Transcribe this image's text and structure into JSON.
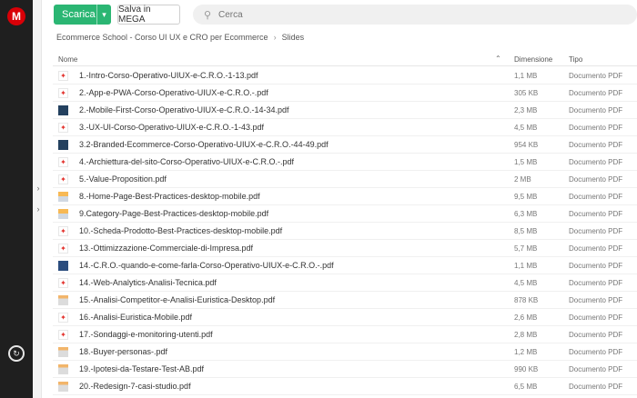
{
  "app": {
    "logo_text": "M",
    "brand_color": "#d90007"
  },
  "toolbar": {
    "download_label": "Scarica",
    "save_label": "Salva in MEGA",
    "search_placeholder": "Cerca",
    "download_color": "#2bb673"
  },
  "breadcrumb": {
    "items": [
      "Ecommerce School - Corso UI UX e CRO per Ecommerce",
      "Slides"
    ],
    "separator": "›"
  },
  "table": {
    "columns": {
      "name": "Nome",
      "size": "Dimensione",
      "type": "Tipo"
    },
    "rows": [
      {
        "name": "1.-Intro-Corso-Operativo-UIUX-e-C.R.O.-1-13.pdf",
        "size": "1,1 MB",
        "type": "Documento PDF",
        "icon": "pdf-icon"
      },
      {
        "name": "2.-App-e-PWA-Corso-Operativo-UIUX-e-C.R.O.-.pdf",
        "size": "305 KB",
        "type": "Documento PDF",
        "icon": "pdf-icon"
      },
      {
        "name": "2.-Mobile-First-Corso-Operativo-UIUX-e-C.R.O.-14-34.pdf",
        "size": "2,3 MB",
        "type": "Documento PDF",
        "icon": "thumbnail-dark"
      },
      {
        "name": "3.-UX-UI-Corso-Operativo-UIUX-e-C.R.O.-1-43.pdf",
        "size": "4,5 MB",
        "type": "Documento PDF",
        "icon": "pdf-icon"
      },
      {
        "name": "3.2-Branded-Ecommerce-Corso-Operativo-UIUX-e-C.R.O.-44-49.pdf",
        "size": "954 KB",
        "type": "Documento PDF",
        "icon": "thumbnail-dark"
      },
      {
        "name": "4.-Archiettura-del-sito-Corso-Operativo-UIUX-e-C.R.O.-.pdf",
        "size": "1,5 MB",
        "type": "Documento PDF",
        "icon": "pdf-icon"
      },
      {
        "name": "5.-Value-Proposition.pdf",
        "size": "2 MB",
        "type": "Documento PDF",
        "icon": "pdf-icon"
      },
      {
        "name": "8.-Home-Page-Best-Practices-desktop-mobile.pdf",
        "size": "9,5 MB",
        "type": "Documento PDF",
        "icon": "thumbnail-orange"
      },
      {
        "name": "9.Category-Page-Best-Practices-desktop-mobile.pdf",
        "size": "6,3 MB",
        "type": "Documento PDF",
        "icon": "thumbnail-orange"
      },
      {
        "name": "10.-Scheda-Prodotto-Best-Practices-desktop-mobile.pdf",
        "size": "8,5 MB",
        "type": "Documento PDF",
        "icon": "pdf-icon"
      },
      {
        "name": "13.-Ottimizzazione-Commerciale-di-Impresa.pdf",
        "size": "5,7 MB",
        "type": "Documento PDF",
        "icon": "pdf-icon"
      },
      {
        "name": "14.-C.R.O.-quando-e-come-farla-Corso-Operativo-UIUX-e-C.R.O.-.pdf",
        "size": "1,1 MB",
        "type": "Documento PDF",
        "icon": "thumbnail-blue"
      },
      {
        "name": "14.-Web-Analytics-Analisi-Tecnica.pdf",
        "size": "4,5 MB",
        "type": "Documento PDF",
        "icon": "pdf-icon"
      },
      {
        "name": "15.-Analisi-Competitor-e-Analisi-Euristica-Desktop.pdf",
        "size": "878 KB",
        "type": "Documento PDF",
        "icon": "thumbnail-light"
      },
      {
        "name": "16.-Analisi-Euristica-Mobile.pdf",
        "size": "2,6 MB",
        "type": "Documento PDF",
        "icon": "pdf-icon"
      },
      {
        "name": "17.-Sondaggi-e-monitoring-utenti.pdf",
        "size": "2,8 MB",
        "type": "Documento PDF",
        "icon": "pdf-icon"
      },
      {
        "name": "18.-Buyer-personas-.pdf",
        "size": "1,2 MB",
        "type": "Documento PDF",
        "icon": "thumbnail-light"
      },
      {
        "name": "19.-Ipotesi-da-Testare-Test-AB.pdf",
        "size": "990 KB",
        "type": "Documento PDF",
        "icon": "thumbnail-light"
      },
      {
        "name": "20.-Redesign-7-casi-studio.pdf",
        "size": "6,5 MB",
        "type": "Documento PDF",
        "icon": "thumbnail-light"
      }
    ]
  }
}
